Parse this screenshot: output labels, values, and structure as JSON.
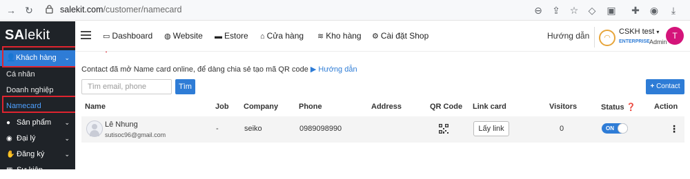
{
  "browser": {
    "url_host": "salekit.com",
    "url_path": "/customer/namecard"
  },
  "sidebar": {
    "logo_prefix": "SA",
    "logo_suffix": "lekit",
    "active_section": "Khách hàng",
    "sub_items": [
      "Cá nhân",
      "Doanh nghiệp",
      "Namecard"
    ],
    "items": [
      "Sản phẩm",
      "Đại lý",
      "Đăng ký",
      "Sự kiện"
    ]
  },
  "topnav": {
    "items": [
      "Dashboard",
      "Website",
      "Estore",
      "Cửa hàng",
      "Kho hàng",
      "Cài đặt Shop"
    ],
    "guide": "Hướng dẫn",
    "user_name": "CSKH test",
    "plan_badge": "ENTERPRISE",
    "role": "Admin",
    "avatar_letter": "T"
  },
  "content": {
    "intro_text": "Contact đã mở Name card online, để dàng chia sẻ tạo mã QR code",
    "intro_link": "Hướng dẫn",
    "search_placeholder": "Tìm email, phone",
    "search_button": "Tìm",
    "add_button": "Contact",
    "columns": [
      "Name",
      "Job",
      "Company",
      "Phone",
      "Address",
      "QR Code",
      "Link card",
      "Visitors",
      "Status",
      "Action"
    ],
    "rows": [
      {
        "name": "Lê Nhung",
        "email": "sutisoc96@gmail.com",
        "job": "-",
        "company": "seiko",
        "phone": "0989098990",
        "address": "",
        "link_button": "Lấy link",
        "visitors": "0",
        "status": "ON"
      }
    ]
  },
  "colors": {
    "accent": "#2e7cd6",
    "sidebar_bg": "#1f2328",
    "highlight_box": "#e0242f",
    "avatar": "#d4147a"
  }
}
